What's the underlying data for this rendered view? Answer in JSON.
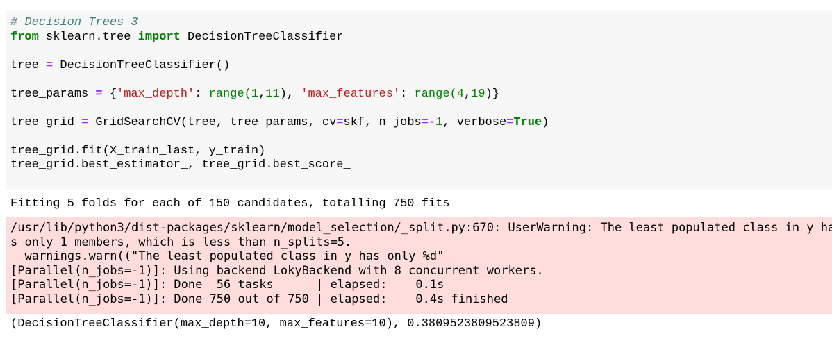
{
  "input_cell": {
    "comment": "# Decision Trees 3",
    "line2": {
      "kw_from": "from",
      "module": " sklearn.tree ",
      "kw_import": "import",
      "name": " DecisionTreeClassifier"
    },
    "line3": {
      "lhs": "tree ",
      "op": "=",
      "rhs": " DecisionTreeClassifier()"
    },
    "line4": {
      "lhs": "tree_params ",
      "op": "=",
      "open": " {",
      "key1": "'max_depth'",
      "colon1": ": ",
      "fn1": "range(",
      "n1a": "1",
      "comma1": ",",
      "n1b": "11",
      "close1": "), ",
      "key2": "'max_features'",
      "colon2": ": ",
      "fn2": "range(",
      "n2a": "4",
      "comma2": ",",
      "n2b": "19",
      "close2": ")}"
    },
    "line5": {
      "lhs": "tree_grid ",
      "op": "=",
      "mid1": " GridSearchCV(tree, tree_params, cv",
      "op2": "=",
      "mid2": "skf, n_jobs",
      "op3": "=-",
      "num": "1",
      "mid3": ", verbose",
      "op4": "=",
      "kw_true": "True",
      "end": ")"
    },
    "line6": "tree_grid.fit(X_train_last, y_train)",
    "line7": "tree_grid.best_estimator_, tree_grid.best_score_"
  },
  "stdout": "Fitting 5 folds for each of 150 candidates, totalling 750 fits",
  "stderr": [
    "/usr/lib/python3/dist-packages/sklearn/model_selection/_split.py:670: UserWarning: The least populated class in y ha",
    "s only 1 members, which is less than n_splits=5.",
    "  warnings.warn((\"The least populated class in y has only %d\"",
    "[Parallel(n_jobs=-1)]: Using backend LokyBackend with 8 concurrent workers.",
    "[Parallel(n_jobs=-1)]: Done  56 tasks      | elapsed:    0.1s",
    "[Parallel(n_jobs=-1)]: Done 750 out of 750 | elapsed:    0.4s finished"
  ],
  "result": "(DecisionTreeClassifier(max_depth=10, max_features=10), 0.3809523809523809)"
}
